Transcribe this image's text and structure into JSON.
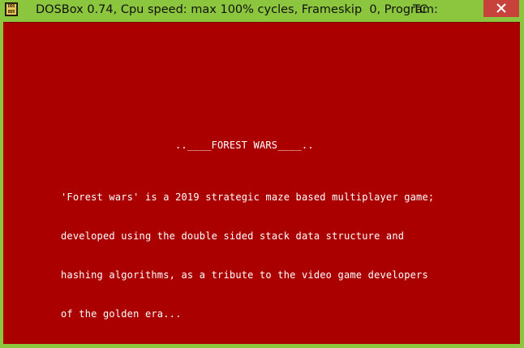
{
  "window": {
    "title": "DOSBox 0.74, Cpu speed: max 100% cycles, Frameskip  0, Program:",
    "program": "TC",
    "icon_lid_text": "DOS",
    "icon_base_text": "BOX",
    "icon": "dosbox-icon",
    "close_icon": "close-icon"
  },
  "screen": {
    "background": "#aa0000",
    "text_color": "#ffffff",
    "heading": "..____FOREST WARS____..",
    "body_lines": [
      "'Forest wars' is a 2019 strategic maze based multiplayer game;",
      "developed using the double sided stack data structure and",
      "hashing algorithms, as a tribute to the video game developers",
      "of the golden era..."
    ]
  },
  "colors": {
    "titlebar": "#8cc63e",
    "close_button": "#c7423a"
  }
}
